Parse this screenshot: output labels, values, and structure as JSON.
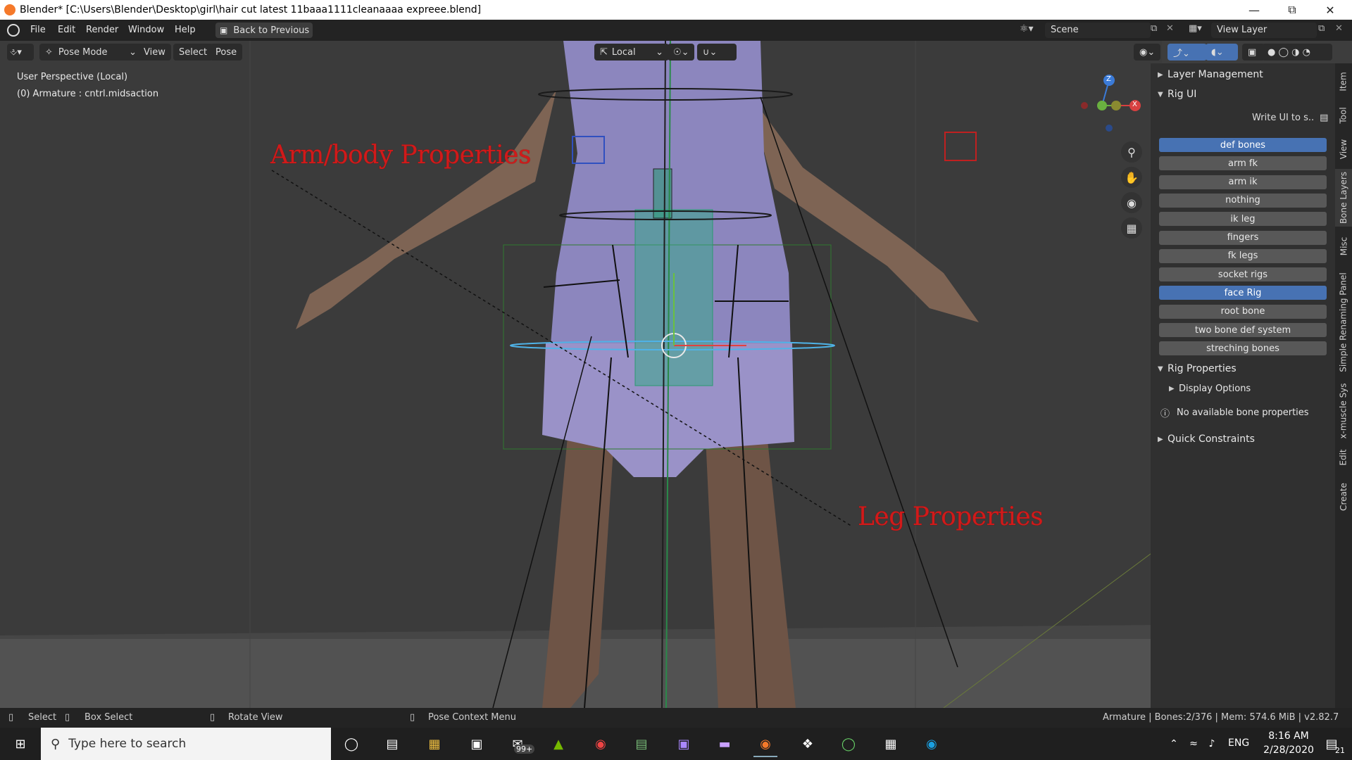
{
  "window": {
    "title": "Blender* [C:\\Users\\Blender\\Desktop\\girl\\hair cut latest 11baaa1111cleanaaaa expreee.blend]"
  },
  "topbar": {
    "menus": [
      "File",
      "Edit",
      "Render",
      "Window",
      "Help"
    ],
    "back_button": "Back to Previous",
    "scene_label": "Scene",
    "view_layer_label": "View Layer"
  },
  "viewport_header": {
    "mode": "Pose Mode",
    "menus": [
      "View",
      "Select",
      "Pose"
    ],
    "orientation": "Local"
  },
  "viewport": {
    "perspective": "User Perspective (Local)",
    "active_object": "(0) Armature : cntrl.midsaction",
    "annotations": [
      "Arm/body Properties",
      "Leg Properties"
    ],
    "gizmo": {
      "z": "Z",
      "x": "X"
    }
  },
  "sidebar": {
    "panels": {
      "layer_management": "Layer Management",
      "rig_ui": "Rig UI",
      "write_ui": "Write UI to s..",
      "rig_properties": "Rig Properties",
      "display_options": "Display Options",
      "no_bone_props": "No available bone properties",
      "quick_constraints": "Quick Constraints"
    },
    "layers": [
      {
        "label": "def bones",
        "active": true
      },
      {
        "label": "arm fk",
        "active": false
      },
      {
        "label": "arm ik",
        "active": false
      },
      {
        "label": "nothing",
        "active": false
      },
      {
        "label": "ik leg",
        "active": false
      },
      {
        "label": "fingers",
        "active": false
      },
      {
        "label": "fk legs",
        "active": false
      },
      {
        "label": "socket rigs",
        "active": false
      },
      {
        "label": "face Rig",
        "active": true
      },
      {
        "label": "root bone",
        "active": false
      },
      {
        "label": "two bone def system",
        "active": false
      },
      {
        "label": "streching bones",
        "active": false
      }
    ],
    "tabs": [
      "Item",
      "Tool",
      "View",
      "Bone Layers",
      "Misc",
      "Simple Renaming Panel",
      "x-muscle Sys",
      "Edit",
      "Create"
    ]
  },
  "statusbar": {
    "select": "Select",
    "box_select": "Box Select",
    "rotate_view": "Rotate View",
    "pose_context": "Pose Context Menu",
    "stats": "Armature | Bones:2/376 | Mem: 574.6 MiB | v2.82.7"
  },
  "taskbar": {
    "search_placeholder": "Type here to search",
    "mail_badge": "99+",
    "language": "ENG",
    "time": "8:16 AM",
    "date": "2/28/2020",
    "notif_count": "21"
  },
  "colors": {
    "accent": "#4772b3",
    "annotation": "#d11a1a",
    "viewport_bg": "#3b3b3b"
  }
}
